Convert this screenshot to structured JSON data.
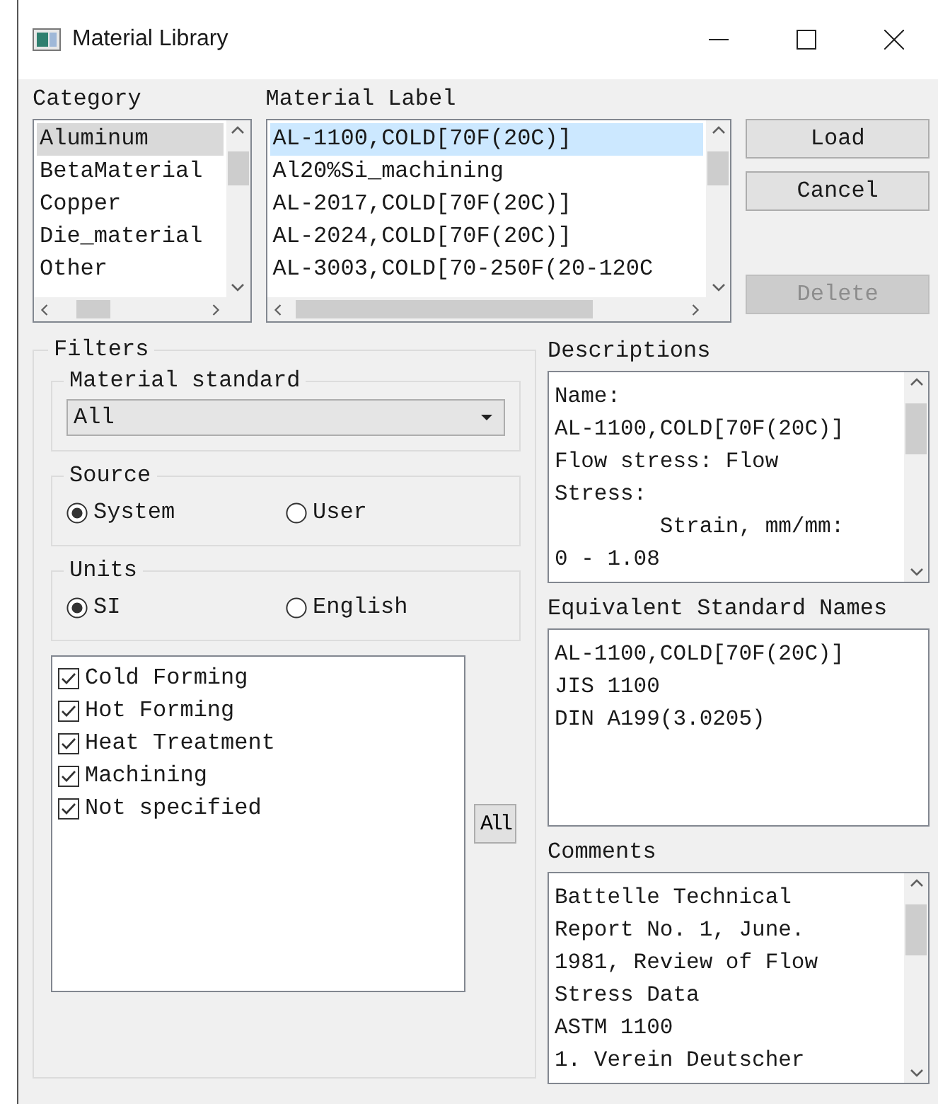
{
  "window": {
    "title": "Material Library"
  },
  "category": {
    "label": "Category",
    "items": [
      {
        "label": "Aluminum",
        "selected": true
      },
      {
        "label": "BetaMaterial",
        "selected": false
      },
      {
        "label": "Copper",
        "selected": false
      },
      {
        "label": "Die_material",
        "selected": false
      },
      {
        "label": "Other",
        "selected": false
      }
    ]
  },
  "material_label": {
    "label": "Material Label",
    "items": [
      {
        "label": "AL-1100,COLD[70F(20C)]",
        "selected": true
      },
      {
        "label": "Al20%Si_machining",
        "selected": false
      },
      {
        "label": "AL-2017,COLD[70F(20C)]",
        "selected": false
      },
      {
        "label": "AL-2024,COLD[70F(20C)]",
        "selected": false
      },
      {
        "label": "AL-3003,COLD[70-250F(20-120C",
        "selected": false
      }
    ]
  },
  "buttons": [
    {
      "label": "Load",
      "disabled": false
    },
    {
      "label": "Cancel",
      "disabled": false
    },
    {
      "label": "Delete",
      "disabled": true
    }
  ],
  "filters": {
    "title": "Filters",
    "material_standard": {
      "label": "Material standard",
      "value": "All"
    },
    "source": {
      "label": "Source",
      "options": [
        {
          "label": "System",
          "selected": true
        },
        {
          "label": "User",
          "selected": false
        }
      ]
    },
    "units": {
      "label": "Units",
      "options": [
        {
          "label": "SI",
          "selected": true
        },
        {
          "label": "English",
          "selected": false
        }
      ]
    },
    "processes": [
      {
        "label": "Cold Forming",
        "checked": true
      },
      {
        "label": "Hot Forming",
        "checked": true
      },
      {
        "label": "Heat Treatment",
        "checked": true
      },
      {
        "label": "Machining",
        "checked": true
      },
      {
        "label": "Not specified",
        "checked": true
      }
    ],
    "all_button": "All"
  },
  "descriptions": {
    "label": "Descriptions",
    "lines": [
      "Name:",
      "AL-1100,COLD[70F(20C)]",
      "Flow stress: Flow",
      "Stress:",
      "        Strain, mm/mm:",
      "0 - 1.08"
    ]
  },
  "equivalent_standard_names": {
    "label": "Equivalent Standard Names",
    "lines": [
      "AL-1100,COLD[70F(20C)]",
      "JIS 1100",
      "DIN A199(3.0205)"
    ]
  },
  "comments": {
    "label": "Comments",
    "lines": [
      "Battelle Technical",
      "Report No. 1, June.",
      "1981, Review of Flow",
      "Stress Data",
      "ASTM 1100",
      "1. Verein Deutscher"
    ]
  }
}
